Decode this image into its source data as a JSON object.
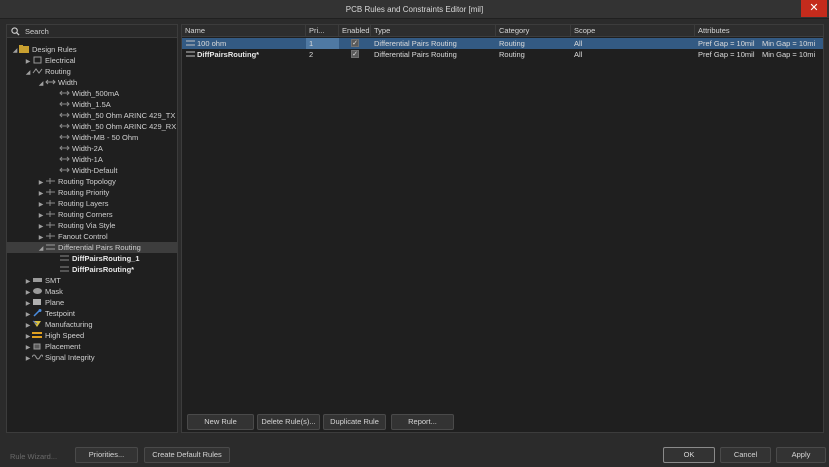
{
  "window": {
    "title": "PCB Rules and Constraints Editor [mil]",
    "close_glyph": "✕"
  },
  "search": {
    "placeholder": "Search"
  },
  "tree": {
    "root": "Design Rules",
    "electrical": "Electrical",
    "routing": "Routing",
    "width": "Width",
    "width_rules": [
      "Width_500mA",
      "Width_1.5A",
      "Width_50 Ohm ARINC 429_TX",
      "Width_50 Ohm ARINC 429_RX",
      "Width-MB - 50 Ohm",
      "Width-2A",
      "Width-1A",
      "Width-Default"
    ],
    "routing_children": [
      "Routing Topology",
      "Routing Priority",
      "Routing Layers",
      "Routing Corners",
      "Routing Via Style",
      "Fanout Control"
    ],
    "diff_pairs": "Differential Pairs Routing",
    "diff_rules": [
      "DiffPairsRouting_1",
      "DiffPairsRouting*"
    ],
    "others": [
      "SMT",
      "Mask",
      "Plane",
      "Testpoint",
      "Manufacturing",
      "High Speed",
      "Placement",
      "Signal Integrity"
    ]
  },
  "table": {
    "headers": [
      "Name",
      "Pri...",
      "Enabled",
      "Type",
      "Category",
      "Scope",
      "Attributes"
    ],
    "rows": [
      {
        "name": "100 ohm",
        "priority": "1",
        "enabled": "✓",
        "type": "Differential Pairs Routing",
        "category": "Routing",
        "scope": "All",
        "attr1": "Pref Gap = 10mil",
        "attr2": "Min Gap = 10mi"
      },
      {
        "name": "DiffPairsRouting*",
        "priority": "2",
        "enabled": "✓",
        "type": "Differential Pairs Routing",
        "category": "Routing",
        "scope": "All",
        "attr1": "Pref Gap = 10mil",
        "attr2": "Min Gap = 10mi"
      }
    ]
  },
  "buttons": {
    "new_rule": "New Rule",
    "delete_rule": "Delete Rule(s)...",
    "duplicate_rule": "Duplicate Rule",
    "report": "Report...",
    "rule_wizard": "Rule Wizard...",
    "priorities": "Priorities...",
    "create_defaults": "Create Default Rules",
    "ok": "OK",
    "cancel": "Cancel",
    "apply": "Apply"
  },
  "colors": {
    "selection": "#335a83",
    "close": "#c42b1c"
  }
}
